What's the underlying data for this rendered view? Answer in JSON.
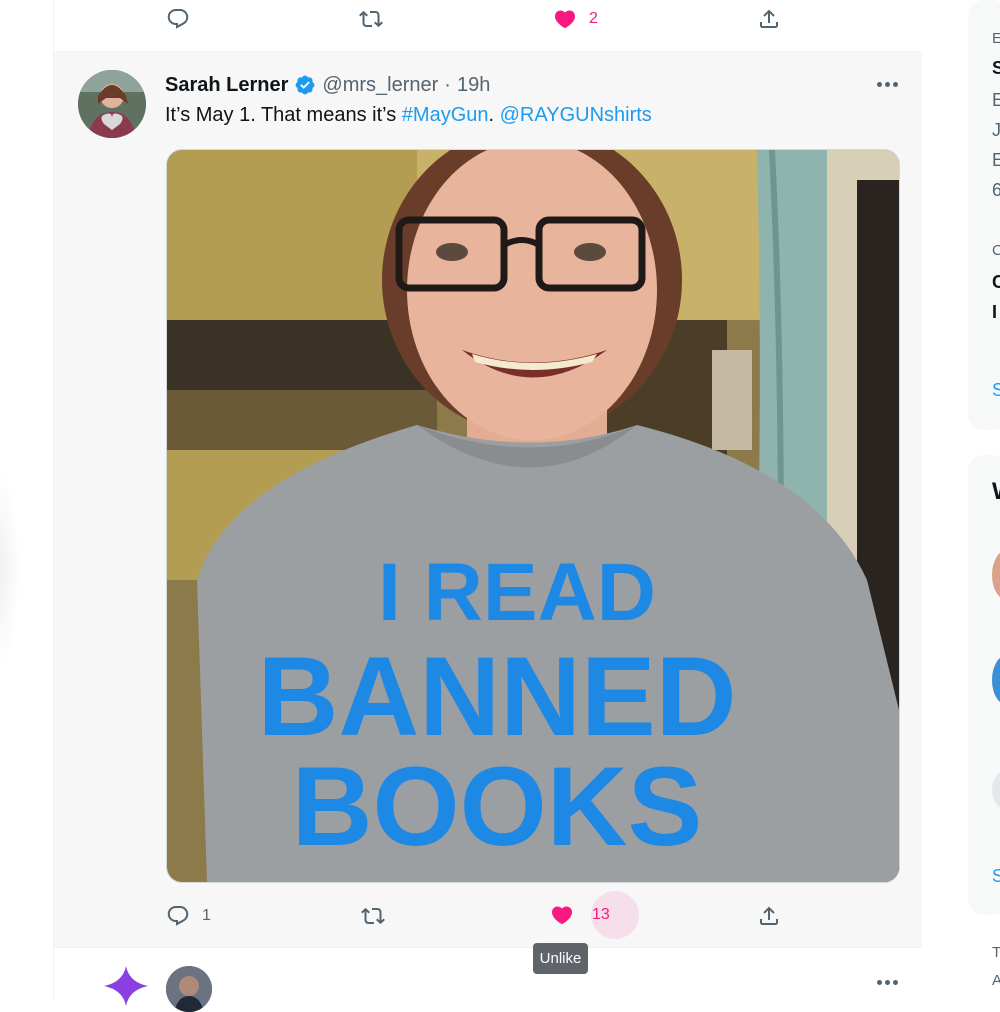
{
  "previous_tweet": {
    "like_count": "2"
  },
  "tweet": {
    "author_name": "Sarah Lerner",
    "handle": "@mrs_lerner",
    "separator": "·",
    "time": "19h",
    "text_prefix": "It’s May 1. That means it’s ",
    "hashtag": "#MayGun",
    "text_middle": ". ",
    "mention": "@RAYGUNshirts",
    "image_alt": "I READ BANNED BOOKS",
    "shirt_line1": "I READ",
    "shirt_line2": "BANNED",
    "shirt_line3": "BOOKS",
    "reply_count": "1",
    "like_count": "13",
    "like_state": "liked"
  },
  "tooltip": {
    "label": "Unlike"
  },
  "sidebar": {
    "fragments": [
      "E",
      "S",
      "E",
      "J",
      "E",
      "6",
      "C",
      "C",
      "I",
      "S",
      "W",
      "S",
      "T",
      "A"
    ]
  },
  "colors": {
    "like_pink": "#f91880",
    "link_blue": "#1d9bf0",
    "icon_gray": "#536471",
    "shirt_blue": "#1e88e5"
  }
}
